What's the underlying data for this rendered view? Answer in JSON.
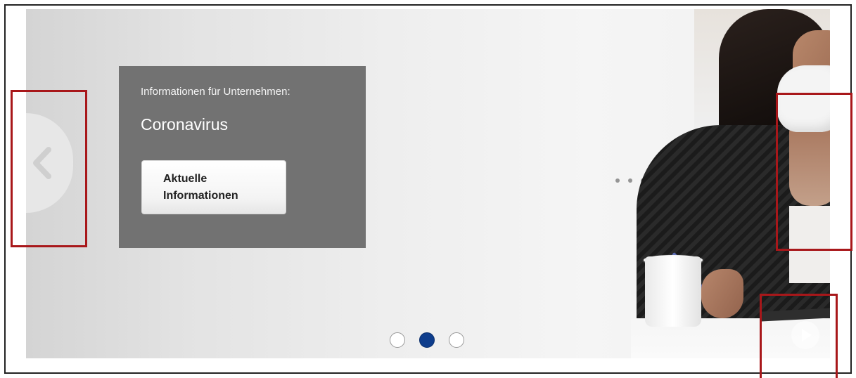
{
  "banner": {
    "eyebrow": "Informationen für Unternehmen:",
    "title": "Coronavirus",
    "cta_line1": "Aktuelle",
    "cta_line2": "Informationen"
  },
  "carousel": {
    "slide_count": 3,
    "active_slide": 2,
    "prev_icon": "chevron-left-icon",
    "next_icon": "play-icon"
  },
  "colors": {
    "active_dot": "#0e3d8c",
    "panel": "#727272",
    "annotation": "#a8171a"
  }
}
